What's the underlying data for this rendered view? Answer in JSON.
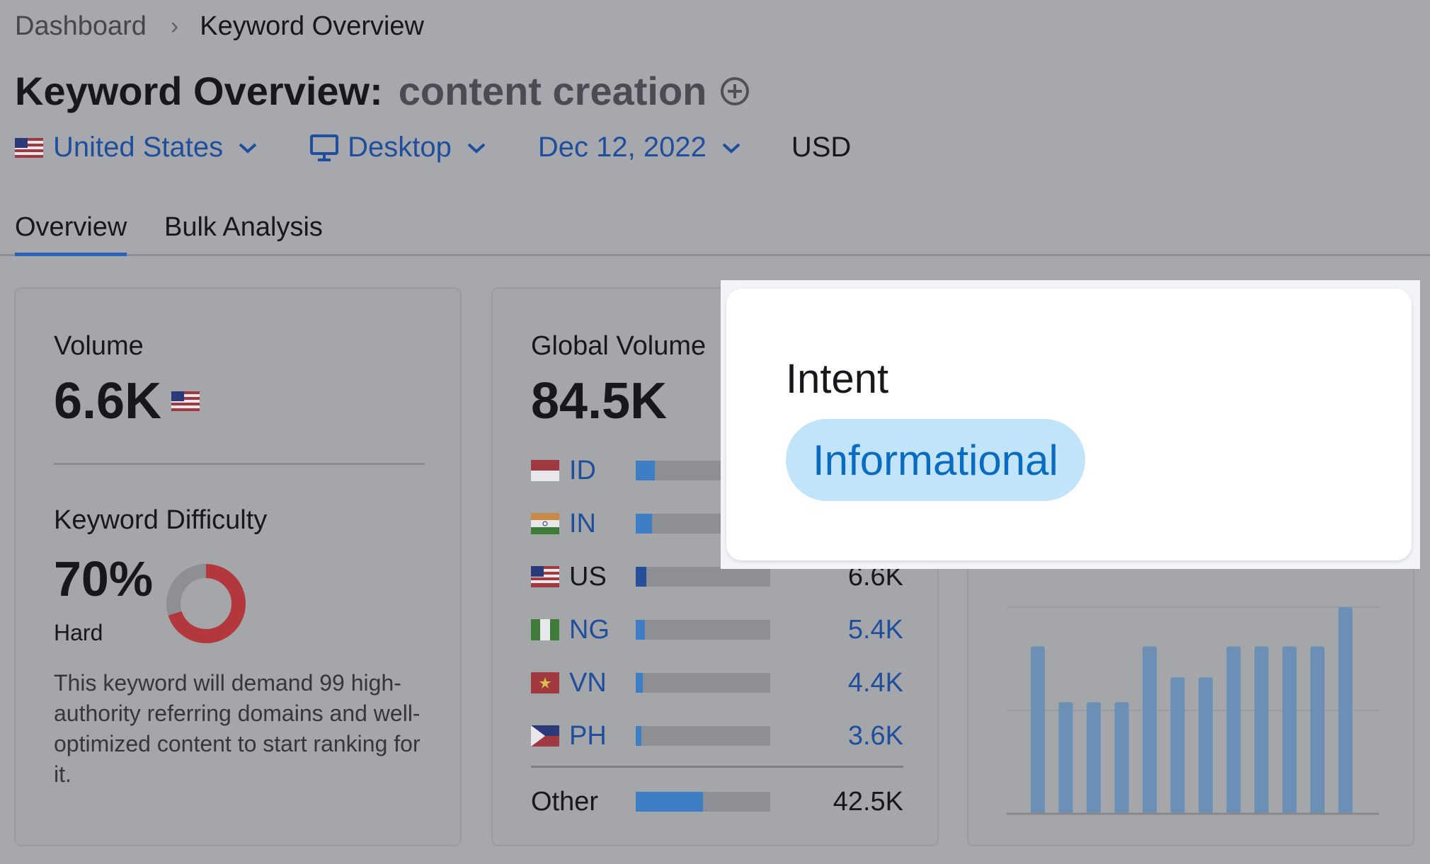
{
  "breadcrumb": {
    "home": "Dashboard",
    "current": "Keyword Overview"
  },
  "header": {
    "title": "Keyword Overview:",
    "keyword": "content creation"
  },
  "filters": {
    "country": "United States",
    "device": "Desktop",
    "date": "Dec 12, 2022",
    "currency": "USD"
  },
  "tabs": [
    {
      "label": "Overview"
    },
    {
      "label": "Bulk Analysis"
    }
  ],
  "volume": {
    "label": "Volume",
    "value": "6.6K"
  },
  "difficulty": {
    "label": "Keyword Difficulty",
    "value": "70%",
    "level": "Hard",
    "percent": 70,
    "description": "This keyword will demand 99 high-authority referring domains and well-optimized content to start ranking for it."
  },
  "global_volume": {
    "label": "Global Volume",
    "value": "84.5K",
    "countries": [
      {
        "code": "ID",
        "value": "",
        "share": 0.14
      },
      {
        "code": "IN",
        "value": "",
        "share": 0.12
      },
      {
        "code": "US",
        "value": "6.6K",
        "share": 0.08
      },
      {
        "code": "NG",
        "value": "5.4K",
        "share": 0.07
      },
      {
        "code": "VN",
        "value": "4.4K",
        "share": 0.05
      },
      {
        "code": "PH",
        "value": "3.6K",
        "share": 0.04
      }
    ],
    "other": {
      "label": "Other",
      "value": "42.5K",
      "share": 0.5
    }
  },
  "trend": {
    "values": [
      0.81,
      0.54,
      0.54,
      0.54,
      0.81,
      0.66,
      0.66,
      0.81,
      0.81,
      0.81,
      0.81,
      1.0
    ]
  },
  "popup": {
    "label": "Intent",
    "badge": "Informational"
  },
  "colors": {
    "link": "#1f4f9c",
    "accent_tab": "#2962b6",
    "bar": "#3e7ec4",
    "donut_red": "#b3383d",
    "badge_bg": "#c2e4fb",
    "badge_text": "#0a6cc1"
  },
  "icons": {
    "add": "plus-circle-icon",
    "chevron": "chevron-down-icon",
    "device": "monitor-icon",
    "flag": "us-flag-icon"
  }
}
